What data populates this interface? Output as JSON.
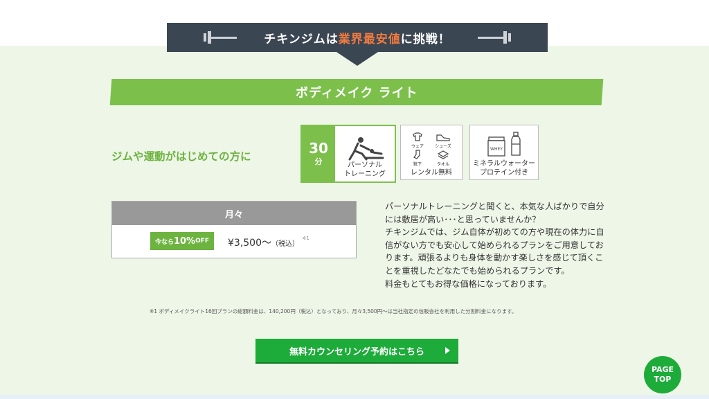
{
  "banner": {
    "part1": "チキンジムは",
    "highlight": "業界最安値",
    "part2": "に挑戦！"
  },
  "plan": {
    "title": "ボディメイク ライト",
    "intro": "ジムや運動がはじめての方に"
  },
  "features": {
    "minutes_value": "30",
    "minutes_unit": "分",
    "training_label": "パーソナル\nトレーニング",
    "rental": {
      "wear": "ウェア",
      "shoes": "シューズ",
      "socks": "靴下",
      "towel": "タオル",
      "label": "レンタル無料"
    },
    "drinks": {
      "whey": "WHEY",
      "label": "ミネラルウォーター\nプロテイン付き"
    }
  },
  "price": {
    "header": "月々",
    "discount_prefix": "今なら",
    "discount_value": "10%",
    "discount_suffix": "OFF",
    "amount": "¥3,500〜",
    "tax": "（税込）",
    "note": "※1"
  },
  "description": [
    "パーソナルトレーニングと聞くと、本気な人ばかりで自分には敷居が高い･･･と思っていませんか？",
    "チキンジムでは、ジム自体が初めての方や現在の体力に自信がない方でも安心して始められるプランをご用意しております。頑張るよりも身体を動かす楽しさを感じて頂くことを重視したどなたでも始められるプランです。",
    "料金もとてもお得な価格になっております。"
  ],
  "footnote": "※1 ボディメイクライト16回プランの総額料金は、140,200円（税込）となっており、月々3,500円〜は当社指定の信販会社を利用した分割料金になります。",
  "cta_label": "無料カウンセリング予約はこちら",
  "page_top": {
    "line1": "PAGE",
    "line2": "TOP"
  },
  "colors": {
    "green": "#7cc04b",
    "dark": "#3b4653",
    "orange": "#f07a3f",
    "cta_green": "#1dab3a"
  }
}
